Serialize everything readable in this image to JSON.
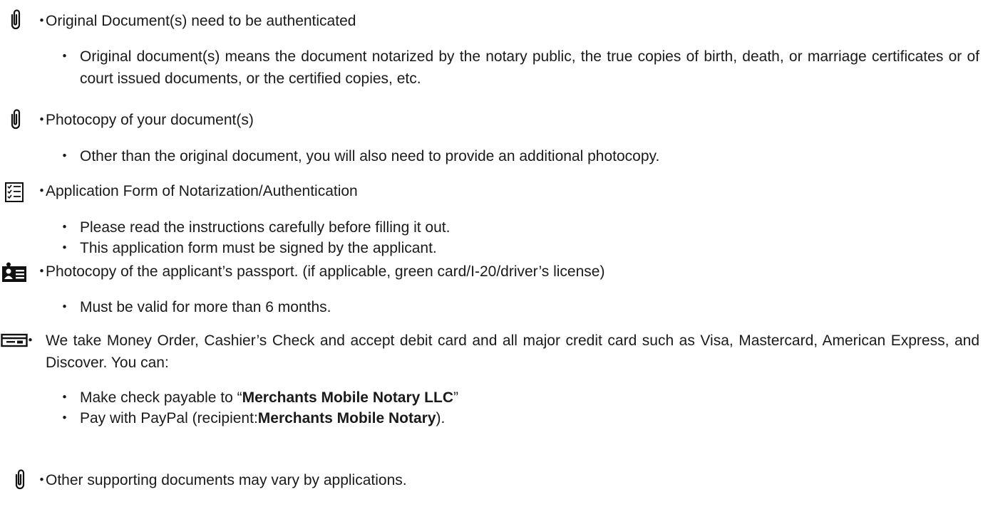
{
  "bullet": "・",
  "items": [
    {
      "icon": "paperclip-icon",
      "text": "Original Document(s) need to be authenticated",
      "subs": [
        "Original document(s) means the document notarized by the notary public, the true copies of birth, death, or marriage certificates or of court issued documents, or the certified copies, etc."
      ]
    },
    {
      "icon": "paperclip-icon",
      "text": "Photocopy of your document(s)",
      "subs": [
        "Other than the original document, you will also need to provide an additional photocopy."
      ]
    },
    {
      "icon": "checklist-icon",
      "text": "Application Form of Notarization/Authentication",
      "subs": [
        "Please read the instructions carefully before filling it out.",
        "This application form must be signed by the applicant."
      ]
    },
    {
      "icon": "id-card-icon",
      "text": "Photocopy of the applicant’s passport. (if applicable, green card/I-20/driver’s license)",
      "subs": [
        "Must be valid for more than 6 months."
      ]
    },
    {
      "icon": "check-payment-icon",
      "text": "We take Money Order, Cashier’s Check and accept debit card and all major credit card such as Visa, Mastercard, American Express, and Discover. You can:",
      "subs_rich": [
        {
          "pre": "Make check payable to “",
          "bold": "Merchants Mobile Notary LLC",
          "post": "”"
        },
        {
          "pre": "Pay with PayPal (recipient:",
          "bold": "Merchants Mobile Notary",
          "post": ")."
        }
      ]
    },
    {
      "icon": "paperclip-icon",
      "text": "Other supporting documents may vary by applications.",
      "subs": []
    }
  ]
}
